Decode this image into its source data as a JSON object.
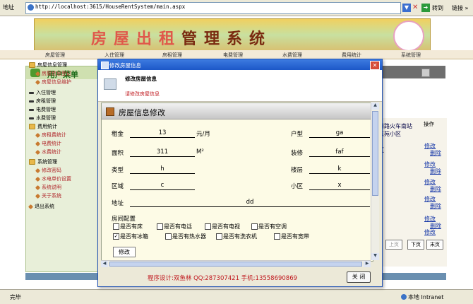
{
  "browser": {
    "address_label": "地址",
    "url": "http://localhost:3615/HouseRentSystem/main.aspx",
    "go_label": "转到",
    "links_label": "链接 »",
    "status_left": "完毕",
    "status_zone": "本地 Intranet"
  },
  "banner": {
    "title_part1": "房屋出租",
    "title_part2": "管理系统"
  },
  "menubar": [
    "房屋管理",
    "入住管理",
    "房租管理",
    "电费管理",
    "水费管理",
    "费用统计",
    "系统管理"
  ],
  "sidebar": {
    "title": "用户菜单",
    "items": [
      {
        "label": "房屋信息管理",
        "type": "folder"
      },
      {
        "label": "房屋信息登记",
        "type": "child"
      },
      {
        "label": "房屋信息维护",
        "type": "child"
      },
      {
        "label": "入住管理",
        "type": "pen"
      },
      {
        "label": "房租管理",
        "type": "pen"
      },
      {
        "label": "电费管理",
        "type": "pen"
      },
      {
        "label": "水费管理",
        "type": "pen"
      },
      {
        "label": "费用统计",
        "type": "folder"
      },
      {
        "label": "房租费统计",
        "type": "child"
      },
      {
        "label": "电费统计",
        "type": "child"
      },
      {
        "label": "水费统计",
        "type": "child"
      },
      {
        "label": "系统管理",
        "type": "folder"
      },
      {
        "label": "修改密码",
        "type": "child"
      },
      {
        "label": "水电单价设置",
        "type": "child"
      },
      {
        "label": "系统说明",
        "type": "child"
      },
      {
        "label": "关于系统",
        "type": "child"
      },
      {
        "label": "退出系统",
        "type": "diamond"
      }
    ]
  },
  "table": {
    "op_header": "操作",
    "cell_texts": [
      "州路火车南站",
      "东苑小区",
      "区"
    ],
    "row_actions": [
      "修改",
      "删除"
    ],
    "pager": [
      "上页",
      "下页",
      "末页"
    ]
  },
  "modal": {
    "title": "修改房屋信息",
    "header_title": "修改房屋信息",
    "header_sub": "请修改房屋信息",
    "section_title": "房屋信息修改",
    "fields": {
      "rent": {
        "label": "租金",
        "value": "13",
        "unit": "元/月"
      },
      "layout": {
        "label": "户型",
        "value": "ga"
      },
      "area": {
        "label": "面积",
        "value": "311",
        "unit": "M²"
      },
      "decor": {
        "label": "装修",
        "value": "faf"
      },
      "type": {
        "label": "类型",
        "value": "h"
      },
      "floor": {
        "label": "楼层",
        "value": "k"
      },
      "district": {
        "label": "区域",
        "value": "c"
      },
      "community": {
        "label": "小区",
        "value": "x"
      },
      "address": {
        "label": "地址",
        "value": "dd"
      }
    },
    "config_label": "房间配置",
    "checkboxes": [
      {
        "label": "是否有床",
        "checked": false
      },
      {
        "label": "是否有电话",
        "checked": false
      },
      {
        "label": "是否有电视",
        "checked": false
      },
      {
        "label": "是否有空调",
        "checked": false
      },
      {
        "label": "是否有冰箱",
        "checked": true
      },
      {
        "label": "是否有热水器",
        "checked": false
      },
      {
        "label": "是否有洗衣机",
        "checked": false
      },
      {
        "label": "是否有宽带",
        "checked": false
      }
    ],
    "edit_button": "修改",
    "footer": "程序设计:双鱼林 QQ:287307421 手机:13558690869",
    "close_button": "关 闭"
  }
}
